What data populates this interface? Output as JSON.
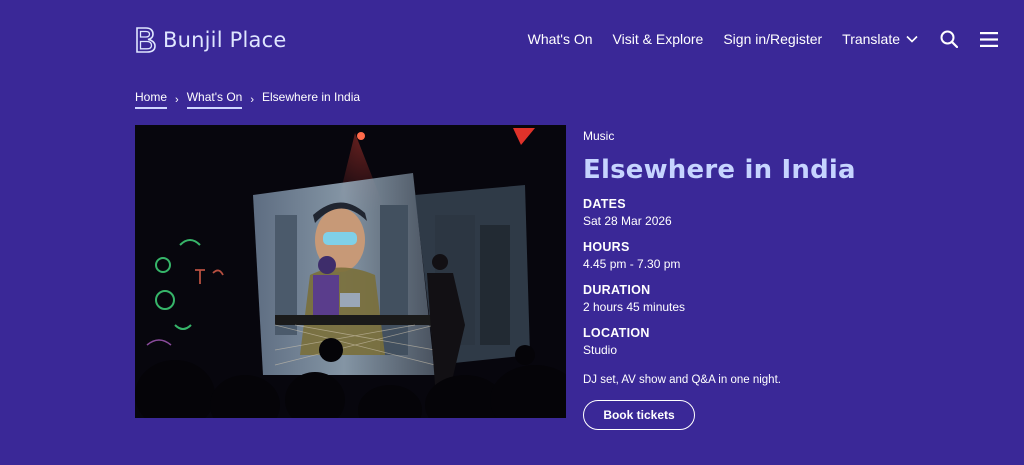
{
  "brand": {
    "name": "Bunjil Place"
  },
  "nav": {
    "items": [
      "What's On",
      "Visit & Explore",
      "Sign in/Register"
    ],
    "translate_label": "Translate",
    "icons": [
      "search-icon",
      "menu-icon",
      "chevron-down-icon"
    ]
  },
  "breadcrumb": {
    "links": [
      "Home",
      "What's On"
    ],
    "current": "Elsewhere in India"
  },
  "hero_image": {
    "subject": "DJ performing on stage with projected visuals"
  },
  "event": {
    "category": "Music",
    "title": "Elsewhere in India",
    "dates_label": "DATES",
    "dates_value": "Sat 28 Mar 2026",
    "hours_label": "HOURS",
    "hours_value": "4.45 pm - 7.30 pm",
    "duration_label": "DURATION",
    "duration_value": "2 hours 45 minutes",
    "location_label": "LOCATION",
    "location_value": "Studio",
    "summary": "DJ set, AV show and Q&A in one night.",
    "book_label": "Book tickets"
  },
  "colors": {
    "background": "#3a2897",
    "title": "#c6d4ff",
    "text": "#ffffff"
  }
}
